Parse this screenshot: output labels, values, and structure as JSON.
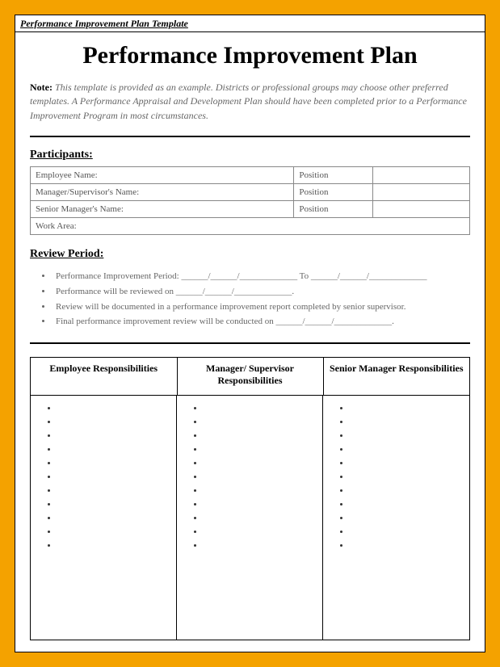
{
  "header_label": "Performance Improvement Plan Template",
  "title": "Performance Improvement Plan",
  "note_label": "Note:",
  "note_body": "This template is provided as an example. Districts or professional groups may choose other preferred templates. A Performance Appraisal and Development Plan should have been completed prior to a Performance Improvement Program in most circumstances.",
  "participants": {
    "heading": "Participants:",
    "rows": {
      "r1_label": "Employee Name:",
      "r1_pos": "Position",
      "r2_label": "Manager/Supervisor's Name:",
      "r2_pos": "Position",
      "r3_label": "Senior Manager's Name:",
      "r3_pos": "Position",
      "r4_label": "Work Area:"
    }
  },
  "review": {
    "heading": "Review Period:",
    "items": {
      "i1": "Performance Improvement Period: ______/______/_____________ To ______/______/_____________",
      "i2": "Performance will be reviewed on ______/______/_____________.",
      "i3": "Review will be documented in a performance improvement report completed by senior supervisor.",
      "i4": "Final performance improvement review will be conducted on ______/______/_____________."
    }
  },
  "responsibilities": {
    "col1_head": "Employee Responsibilities",
    "col2_head": "Manager/ Supervisor Responsibilities",
    "col3_head": "Senior Manager Responsibilities"
  }
}
